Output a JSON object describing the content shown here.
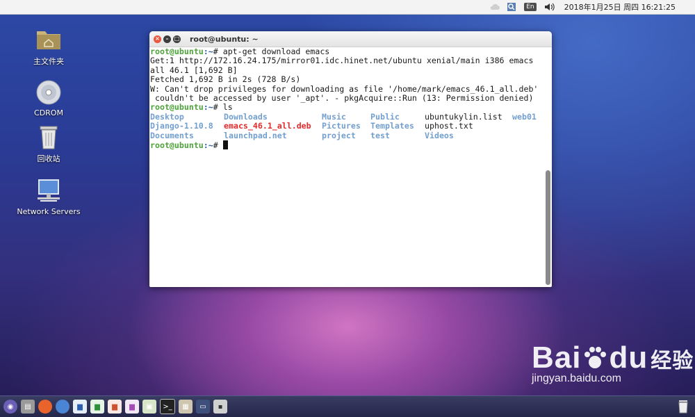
{
  "top_panel": {
    "icons": [
      "cloud-icon",
      "search-tool-icon",
      "keyboard-layout-icon",
      "volume-icon"
    ],
    "keyboard_layout": "En",
    "clock": "2018年1月25日 周四 16:21:25"
  },
  "desktop": {
    "icons": [
      {
        "label": "主文件夹",
        "icon": "home-folder-icon"
      },
      {
        "label": "CDROM",
        "icon": "cdrom-icon"
      },
      {
        "label": "回收站",
        "icon": "trash-icon"
      },
      {
        "label": "Network Servers",
        "icon": "network-servers-icon"
      }
    ]
  },
  "terminal": {
    "title": "root@ubuntu: ~",
    "prompt_user": "root@ubuntu",
    "prompt_path": ":~",
    "prompt_sym": "# ",
    "cmd1": "apt-get download emacs",
    "out1": "Get:1 http://172.16.24.175/mirror01.idc.hinet.net/ubuntu xenial/main i386 emacs",
    "out2": "all 46.1 [1,692 B]",
    "out3": "Fetched 1,692 B in 2s (728 B/s)",
    "out4": "W: Can't drop privileges for downloading as file '/home/mark/emacs_46.1_all.deb'",
    "out5": " couldn't be accessed by user '_apt'. - pkgAcquire::Run (13: Permission denied)",
    "cmd2": "ls",
    "ls": [
      [
        "Desktop",
        "Downloads",
        "Music",
        "Public",
        "ubuntukylin.list",
        "web01"
      ],
      [
        "Django-1.10.8",
        "emacs_46.1_all.deb",
        "Pictures",
        "Templates",
        "uphost.txt",
        ""
      ],
      [
        "Documents",
        "launchpad.net",
        "project",
        "test",
        "Videos",
        ""
      ]
    ]
  },
  "watermark": {
    "brand": "Bai",
    "brand2": "du",
    "brand_cn": "经验",
    "url": "jingyan.baidu.com"
  },
  "taskbar": {
    "apps": [
      "start-menu-icon",
      "file-manager-icon",
      "firefox-icon",
      "browser-icon",
      "writer-icon",
      "calc-icon",
      "impress-icon",
      "draw-icon",
      "image-viewer-icon",
      "terminal-icon",
      "calculator-icon",
      "desktop-switch-icon",
      "save-icon"
    ]
  },
  "colors": {
    "prompt_green": "#4ea33a",
    "prompt_blue": "#3465a4",
    "dir_blue": "#729fcf",
    "deb_red": "#e32b2b"
  }
}
